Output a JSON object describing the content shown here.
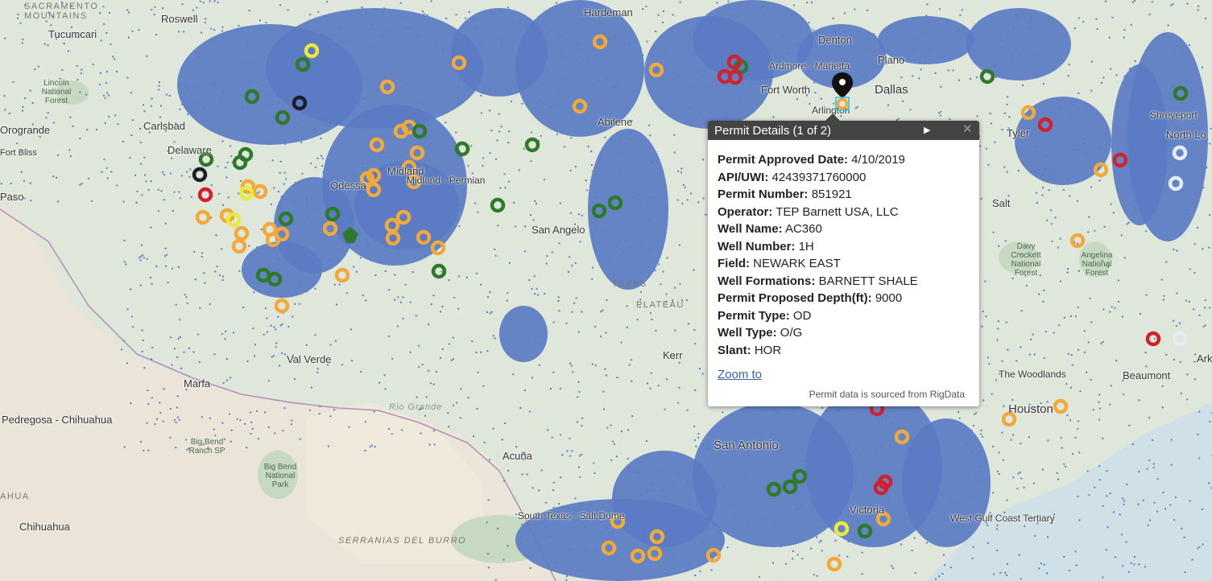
{
  "map": {
    "labels": {
      "sacramento": "SACRAMENTO MOUNTAINS",
      "tucumcari": "Tucumcari",
      "roswell": "Roswell",
      "lincoln": "Lincoln National Forest",
      "carlsbad": "Carlsbad",
      "orogrande": "Orogrande",
      "fort_bliss": "Fort Bliss",
      "paso": "Paso",
      "delaware": "Delaware",
      "odessa": "Odessa",
      "midland": "Midland",
      "permian": "Midland - Permian",
      "san_angelo": "San Angelo",
      "abilene": "Abilene",
      "fort_worth": "Fort Worth",
      "ardmore": "Ardmore - Marietta",
      "denton": "Denton",
      "plano": "Plano",
      "dallas": "Dallas",
      "arlington": "Arlington",
      "hardeman": "Hardeman",
      "tyler": "Tyler",
      "shreveport": "Shreveport",
      "north_lo": "North Lo",
      "kerr": "Kerr",
      "texas": "TEXAS",
      "plateau": "PLATEAU",
      "val_verde": "Val Verde",
      "marfa": "Marfa",
      "pedregosa": "Pedregosa - Chihuahua",
      "big_bend_ranch": "Big Bend Ranch SP",
      "big_bend_np": "Big Bend National Park",
      "ahua": "AHUA",
      "chihuahua": "Chihuahua",
      "serranias": "SERRANIAS DEL BURRO",
      "acuna": "Acuña",
      "rio_grande": "Rio Grande",
      "san_antonio": "San Antonio",
      "south_texas": "South Texas - Salt Dome",
      "victoria": "Victoria",
      "houston": "Houston",
      "beaumont": "Beaumont",
      "woodlands": "The Woodlands",
      "west_gulf": "West Gulf Coast Tertiary",
      "salt": "Salt",
      "angelina": "Angelina National Forest",
      "davy": "Davy Crockett National Forest",
      "ark": "Ark"
    }
  },
  "popup": {
    "title": "Permit Details (1 of 2)",
    "next_icon": "play-triangle",
    "close_icon": "x",
    "fields": [
      {
        "label": "Permit Approved Date:",
        "value": "4/10/2019"
      },
      {
        "label": "API/UWI:",
        "value": "42439371760000"
      },
      {
        "label": "Permit Number:",
        "value": "851921"
      },
      {
        "label": "Operator:",
        "value": "TEP Barnett USA, LLC"
      },
      {
        "label": "Well Name:",
        "value": "AC360"
      },
      {
        "label": "Well Number:",
        "value": "1H"
      },
      {
        "label": "Field:",
        "value": "NEWARK EAST"
      },
      {
        "label": "Well Formations:",
        "value": "BARNETT SHALE"
      },
      {
        "label": "Permit Proposed Depth(ft):",
        "value": "9000"
      },
      {
        "label": "Permit Type:",
        "value": "OD"
      },
      {
        "label": "Well Type:",
        "value": "O/G"
      },
      {
        "label": "Slant:",
        "value": "HOR"
      }
    ],
    "zoom_label": "Zoom to",
    "source_note": "Permit data is sourced from RigData"
  },
  "colors": {
    "well_dots": "#5a7cc4",
    "ring_orange": "#f0a93a",
    "ring_green": "#2f7a2a",
    "ring_red": "#d1202e",
    "ring_yellow": "#eaea3a",
    "ring_black": "#1d1d2a",
    "ring_white": "#e8ecf2",
    "water": "#cfe1e6",
    "land": "#dfe6da",
    "mexico": "#eae5d8",
    "popup_header": "#444444"
  }
}
